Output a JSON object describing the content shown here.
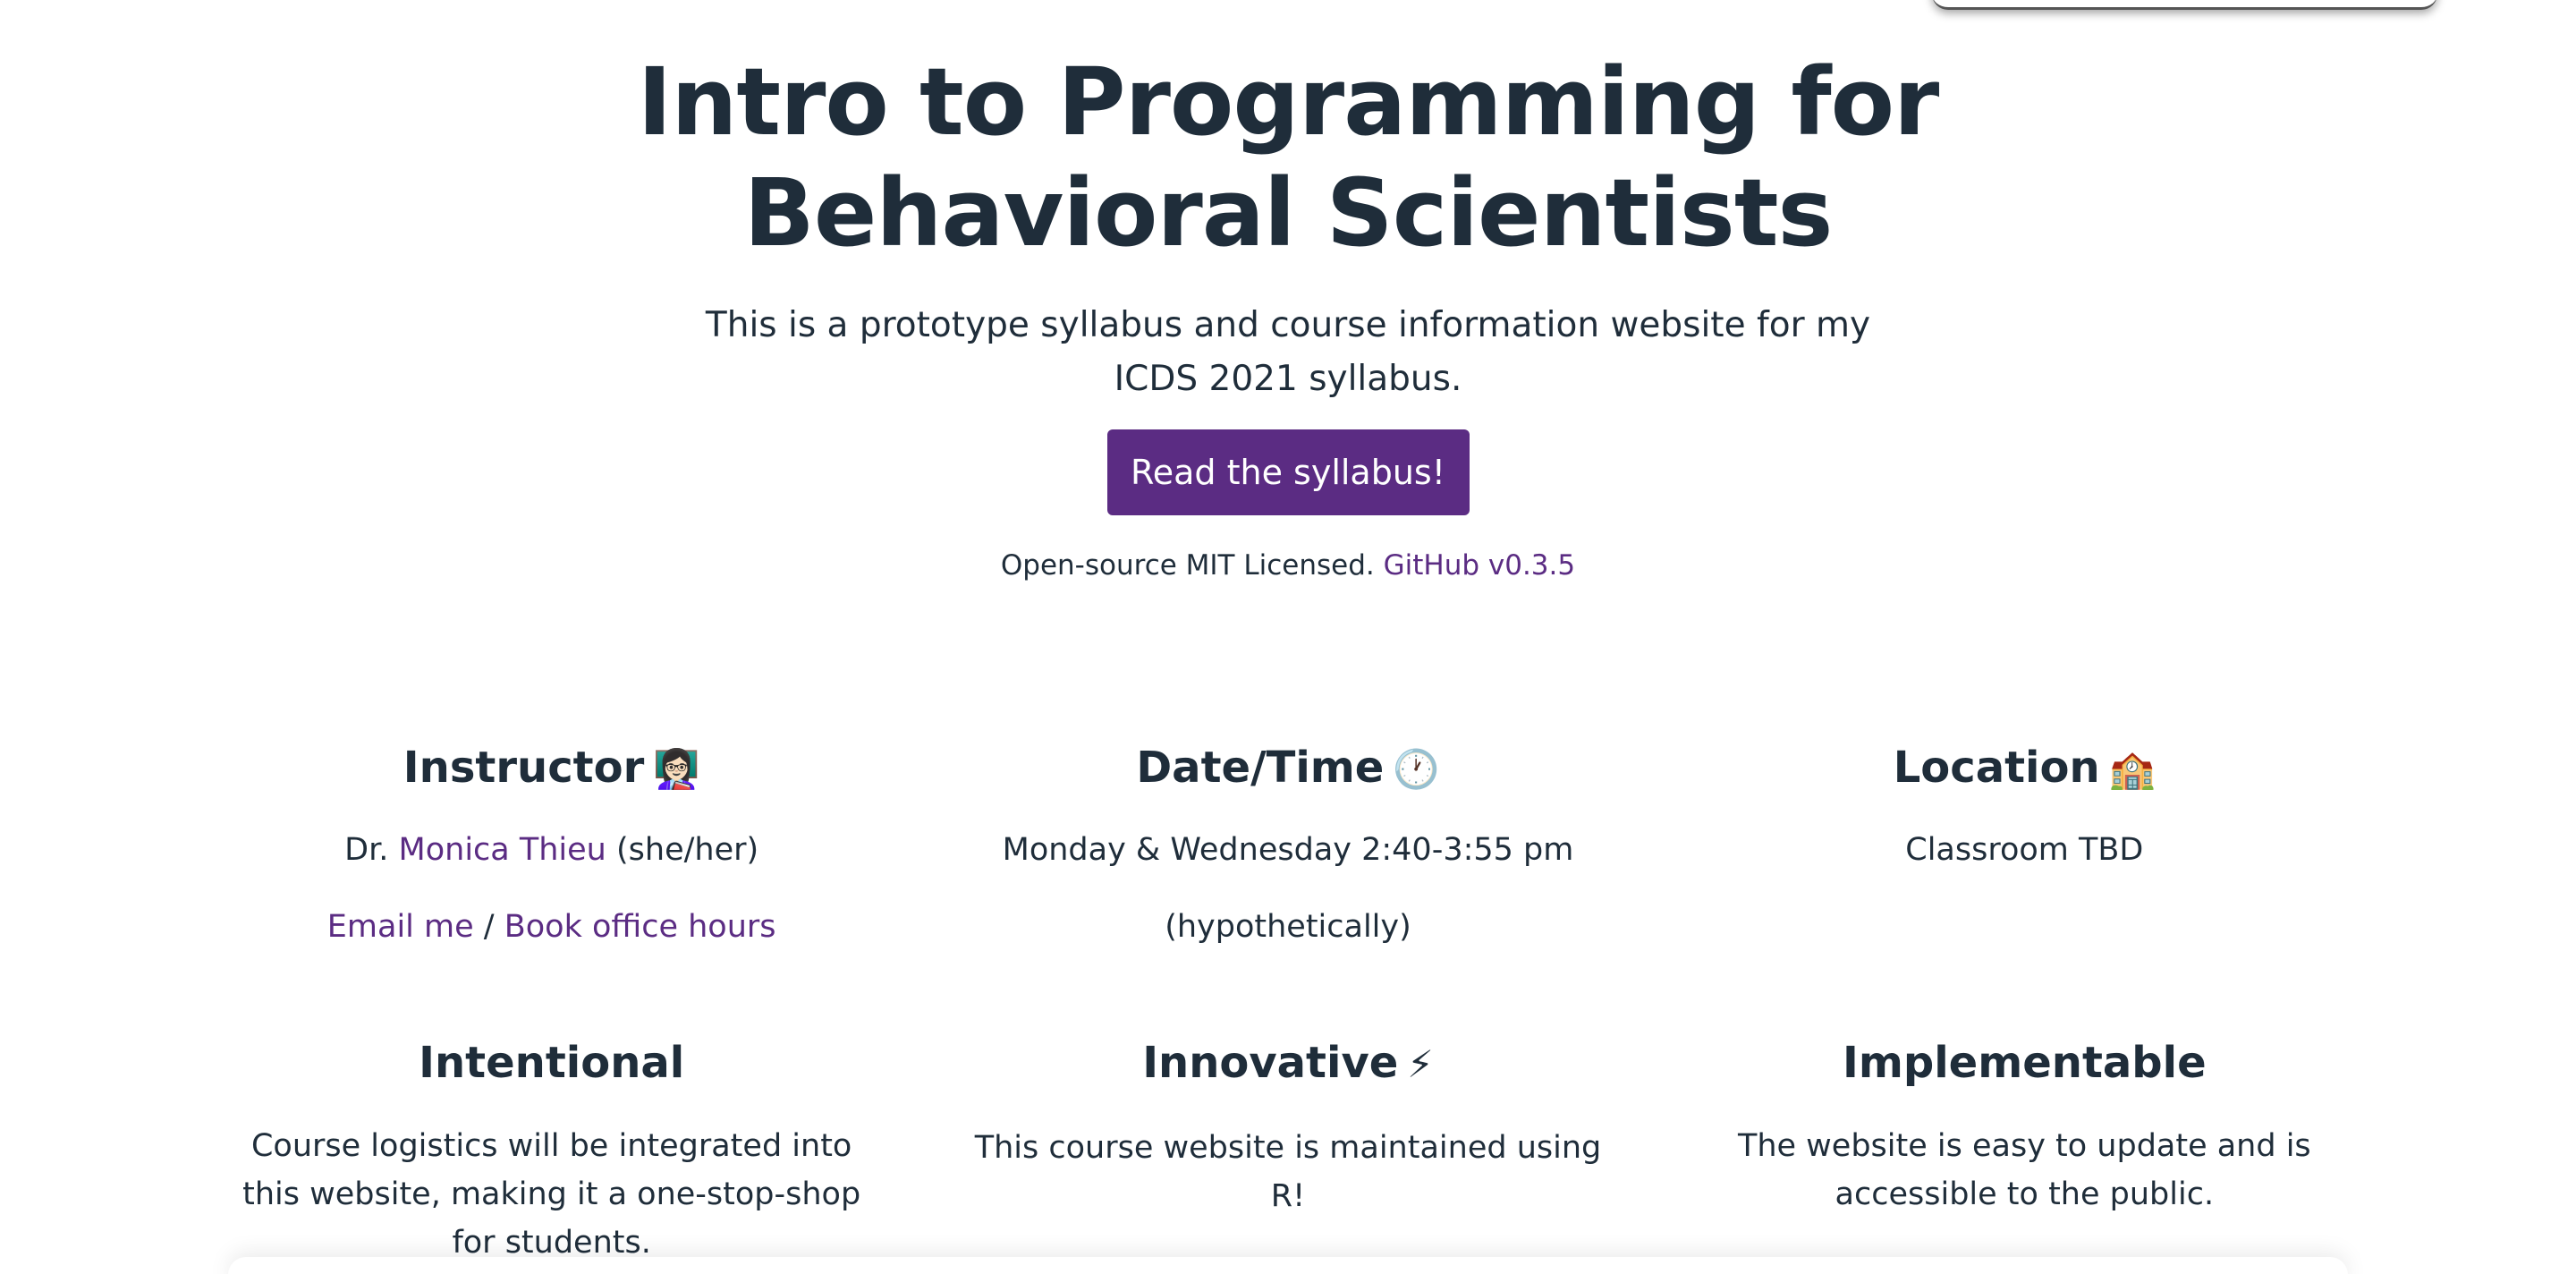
{
  "hero": {
    "title": "Intro to Programming for Behavioral Scientists",
    "description": "This is a prototype syllabus and course information website for my ICDS 2021 syllabus.",
    "button_label": "Read the syllabus!",
    "license_text": "Open-source MIT Licensed.",
    "github_link": "GitHub v0.3.5"
  },
  "info": {
    "instructor": {
      "title": "Instructor",
      "icon": "👩🏻‍🏫",
      "prefix": "Dr.",
      "name_link": "Monica Thieu",
      "pronouns": "(she/her)",
      "email_link": "Email me",
      "separator": "/",
      "office_hours_link": "Book office hours"
    },
    "datetime": {
      "title": "Date/Time",
      "icon": "🕐",
      "line1": "Monday & Wednesday 2:40-3:55 pm",
      "line2": "(hypothetically)"
    },
    "location": {
      "title": "Location",
      "icon": "🏫",
      "line1": "Classroom TBD"
    }
  },
  "features": [
    {
      "title": "Intentional",
      "icon": "",
      "text": "Course logistics will be integrated into this website, making it a one-stop-shop for students."
    },
    {
      "title": "Innovative",
      "icon": "⚡",
      "text": "This course website is maintained using R!"
    },
    {
      "title": "Implementable",
      "icon": "",
      "text": "The website is easy to update and is accessible to the public."
    }
  ],
  "colors": {
    "accent": "#5b2c83",
    "text": "#1f2d3a",
    "background": "#ffffff"
  }
}
